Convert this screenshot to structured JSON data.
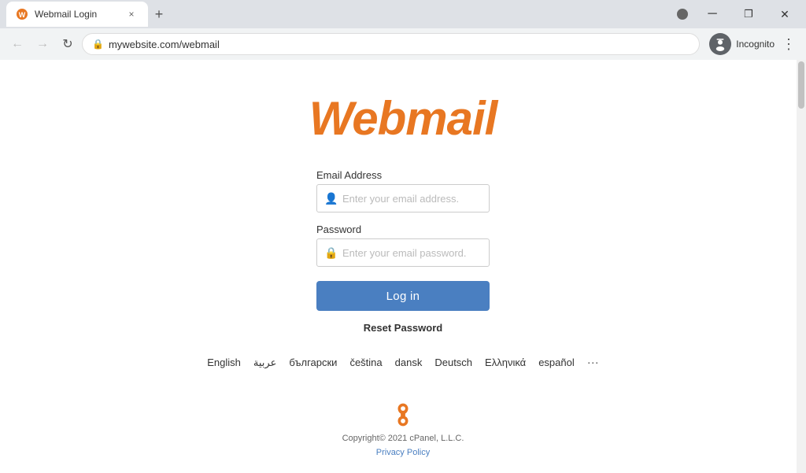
{
  "browser": {
    "tab": {
      "favicon_color": "#e87722",
      "title": "Webmail Login",
      "close_label": "×"
    },
    "new_tab_label": "+",
    "controls": {
      "back_label": "←",
      "forward_label": "→",
      "reload_label": "⟳",
      "address": "mywebsite.com/webmail",
      "lock_icon": "🔒",
      "incognito_label": "Incognito",
      "menu_label": "⋮"
    },
    "caption": {
      "minimize": "─",
      "restore": "❐",
      "close": "✕"
    }
  },
  "page": {
    "logo": "Webmail",
    "form": {
      "email_label": "Email Address",
      "email_placeholder": "Enter your email address.",
      "password_label": "Password",
      "password_placeholder": "Enter your email password.",
      "login_button": "Log in",
      "reset_password": "Reset Password"
    },
    "languages": [
      "English",
      "عربية",
      "български",
      "čeština",
      "dansk",
      "Deutsch",
      "Ελληνικά",
      "español",
      "..."
    ],
    "footer": {
      "copyright": "Copyright© 2021 cPanel, L.L.C.",
      "privacy_policy": "Privacy Policy"
    }
  }
}
